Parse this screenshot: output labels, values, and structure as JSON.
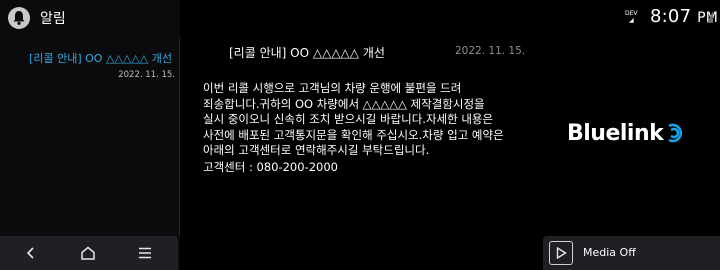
{
  "header": {
    "title": "알림",
    "icon": "bell-icon"
  },
  "notification_list": [
    {
      "title": "[리콜 안내] OO △△△△△ 개선",
      "date": "2022. 11. 15."
    }
  ],
  "message": {
    "title": "[리콜 안내] OO △△△△△ 개선",
    "date": "2022. 11. 15.",
    "body_lines": [
      "이번 리콜 시행으로 고객님의 차량 운행에 불편을 드려",
      "죄송합니다.귀하의 OO 차량에서 △△△△△ 제작결함시정을",
      "실시 중이오니 신속히 조치 받으시길 바랍니다.자세한 내용은",
      "사전에 배포된 고객통지문을 확인해 주십시오.차량 입고 예약은",
      "아래의 고객센터로 연락해주시길 부탁드립니다."
    ],
    "contact": "고객센터 : 080-200-2000"
  },
  "status": {
    "dev_line1": "DEV",
    "dev_line2": "◢",
    "time": "8:07",
    "ampm": "PM"
  },
  "brand": {
    "logo_text": "Bluelink",
    "accent": "#1aa0e6"
  },
  "nav": {
    "back_icon": "back-icon",
    "home_icon": "home-icon",
    "menu_icon": "menu-icon"
  },
  "media": {
    "label": "Media Off",
    "icon": "play-icon"
  },
  "colors": {
    "accent": "#36a9e1",
    "bar": "#1e2024",
    "background": "#000000"
  }
}
